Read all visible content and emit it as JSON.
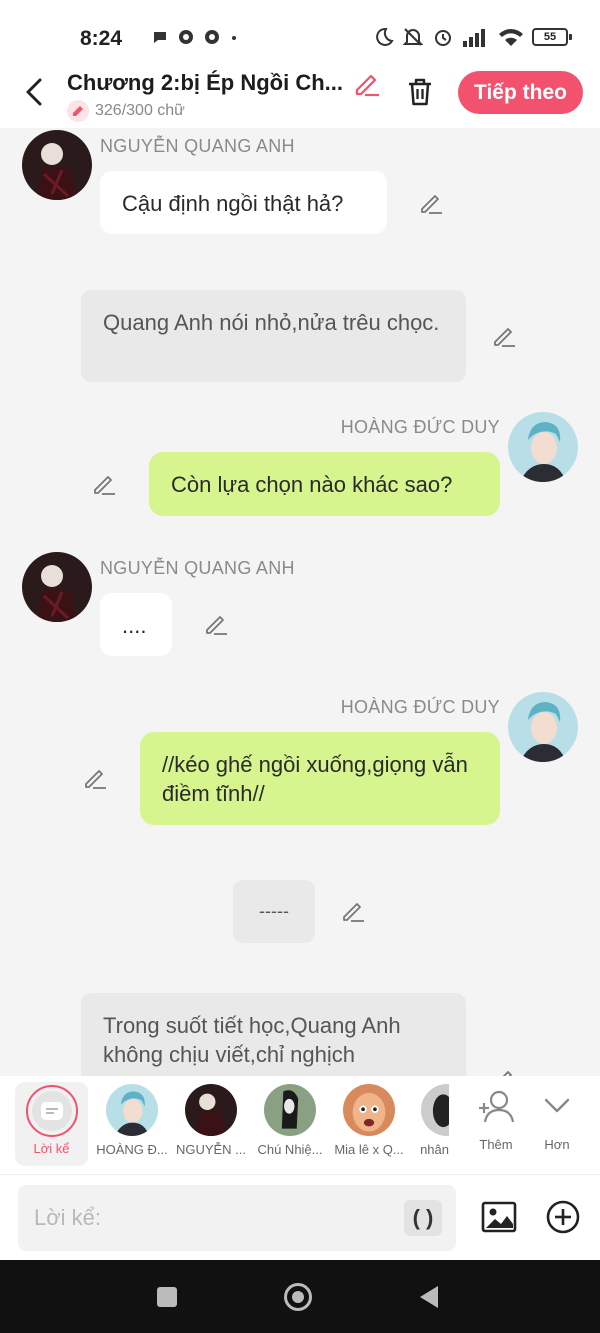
{
  "status_bar": {
    "time": "8:24",
    "battery": "55"
  },
  "header": {
    "chapter_title": "Chương 2:bị Ép Ngồi Ch...",
    "word_count": "326/300 chữ",
    "next_label": "Tiếp theo"
  },
  "messages": [
    {
      "speaker": "NGUYỄN QUANG ANH",
      "text": "Cậu định ngồi thật hả?"
    },
    {
      "text": "Quang Anh nói nhỏ,nửa trêu chọc."
    },
    {
      "speaker": "HOÀNG ĐỨC DUY",
      "text": "Còn lựa chọn nào khác sao?"
    },
    {
      "speaker": "NGUYỄN QUANG ANH",
      "text": "...."
    },
    {
      "speaker": "HOÀNG ĐỨC DUY",
      "text": "//kéo ghế ngồi xuống,giọng vẫn điềm tĩnh//"
    },
    {
      "text": "-----"
    },
    {
      "text": "Trong suốt tiết học,Quang Anh không chịu viết,chỉ nghịch"
    }
  ],
  "characters": {
    "narrator_label": "Lời kể",
    "items": [
      "HOÀNG Đ...",
      "NGUYỄN ...",
      "Chú Nhiệ...",
      "Mia lê x Q...",
      "nhân"
    ],
    "add_label": "Thêm",
    "more_label": "Hơn"
  },
  "input": {
    "placeholder": "Lời kể:",
    "paren_label": "( )"
  },
  "colors": {
    "accent": "#f2526e",
    "bubble_green": "#d6f58e"
  }
}
